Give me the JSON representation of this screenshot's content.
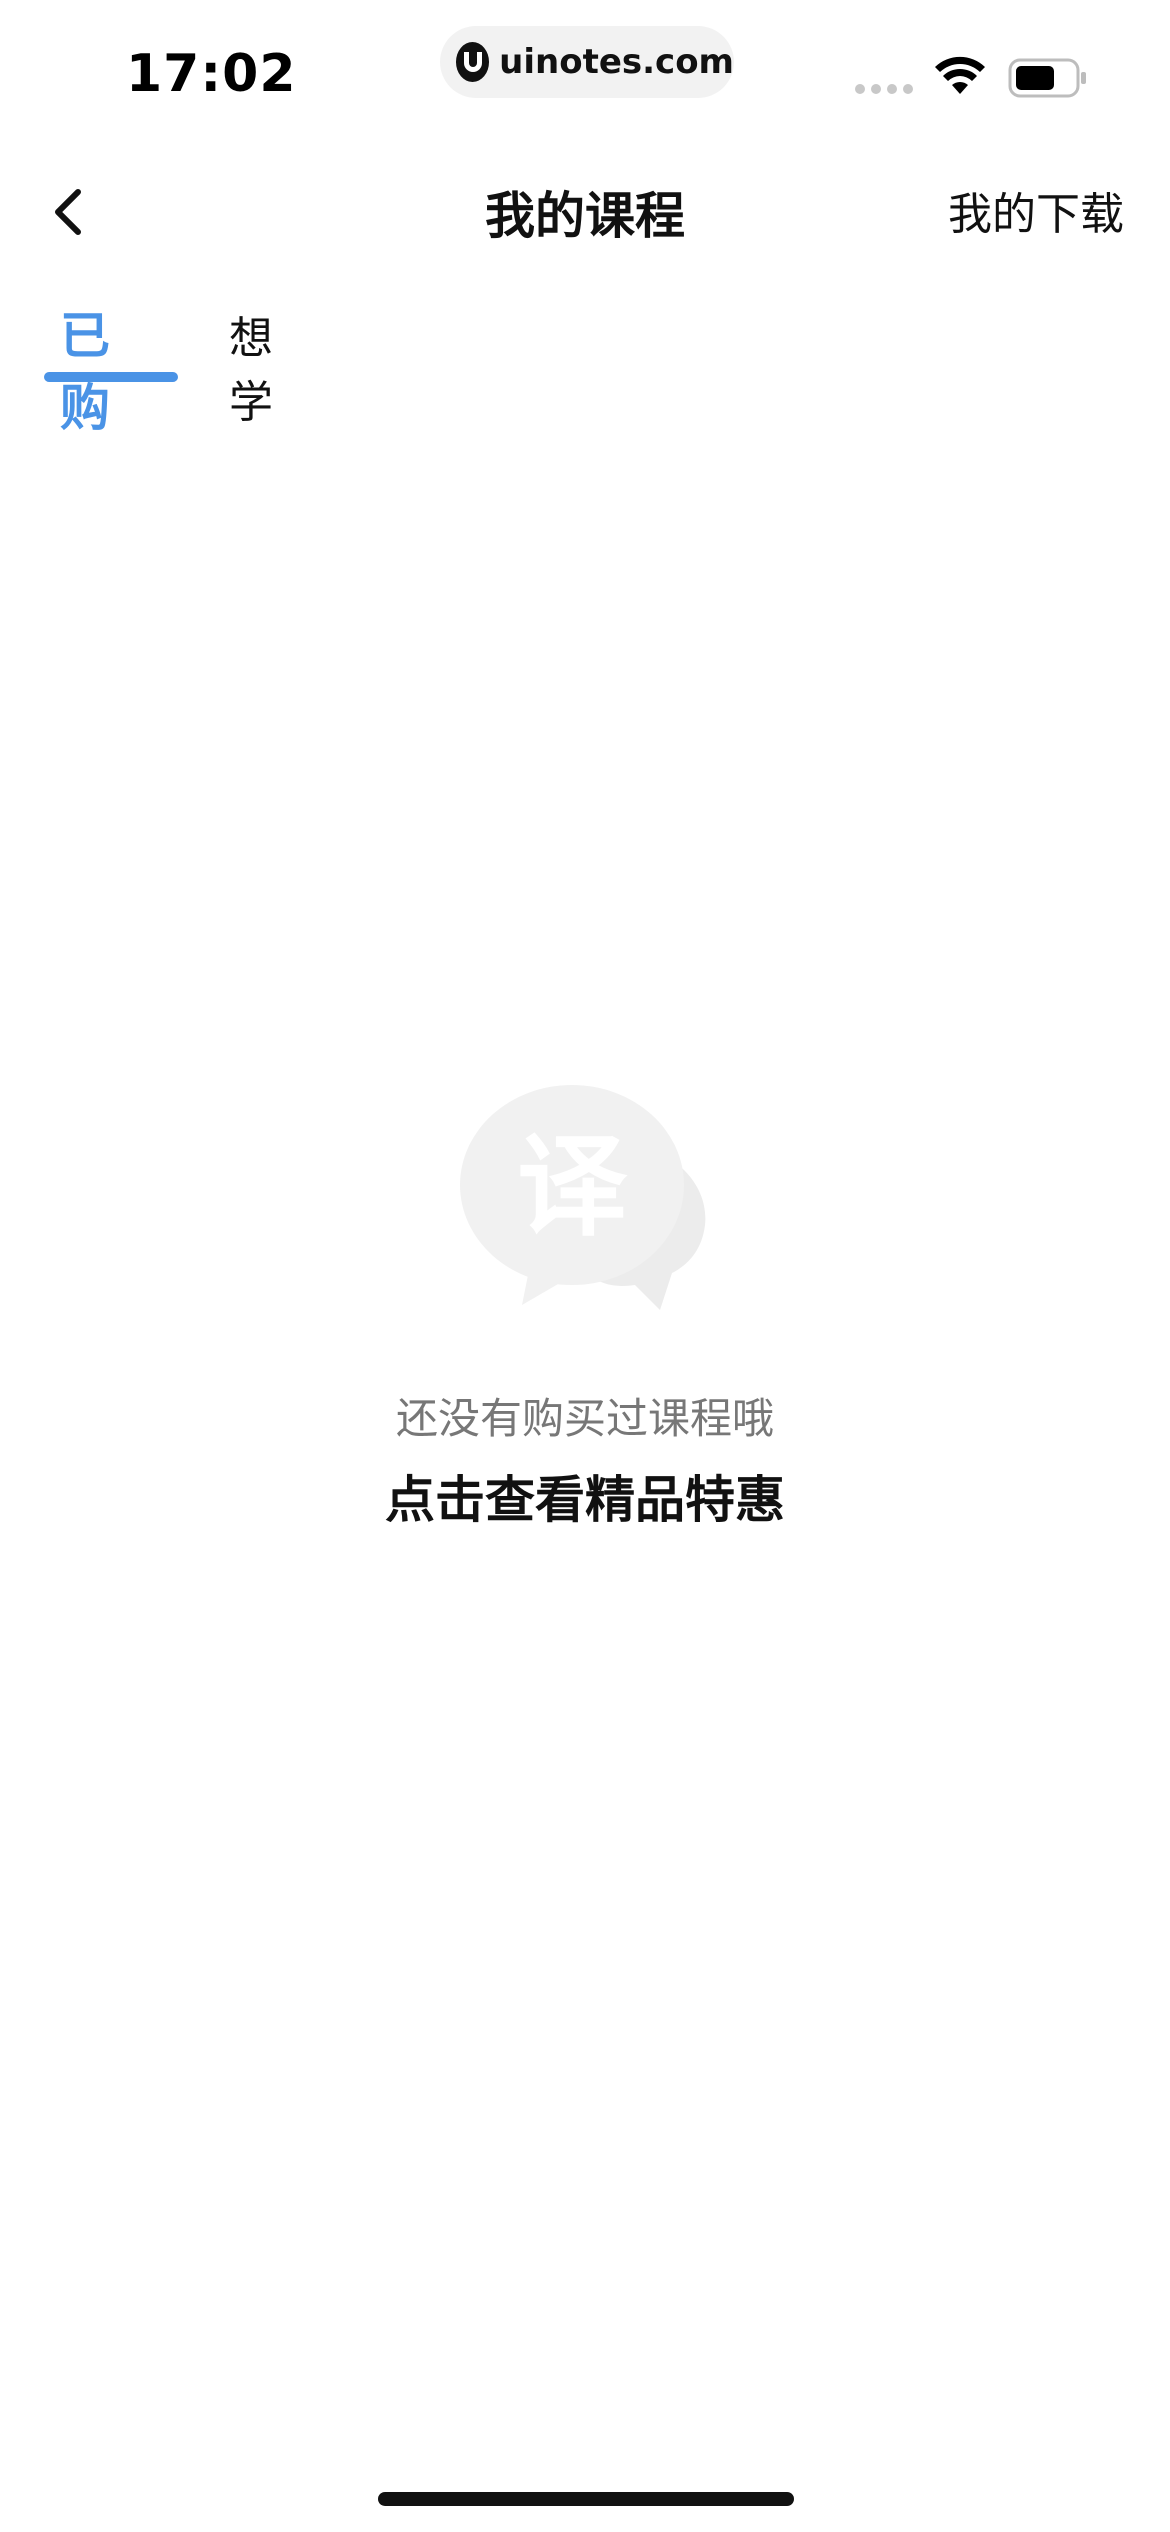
{
  "status_bar": {
    "time": "17:02",
    "url": "uinotes.com",
    "icons": [
      "signal-dots-icon",
      "wifi-icon",
      "battery-icon"
    ]
  },
  "nav": {
    "title": "我的课程",
    "downloads_label": "我的下载",
    "back_icon": "chevron-left-icon"
  },
  "tabs": [
    {
      "label": "已购",
      "active": true
    },
    {
      "label": "想学",
      "active": false
    }
  ],
  "empty_state": {
    "icon": "translate-chat-bubble-icon",
    "icon_glyph": "译",
    "message": "还没有购买过课程哦",
    "cta": "点击查看精品特惠"
  },
  "colors": {
    "accent": "#4a93e6",
    "placeholder_icon": "#f0f0f0",
    "muted_text": "#777777"
  }
}
